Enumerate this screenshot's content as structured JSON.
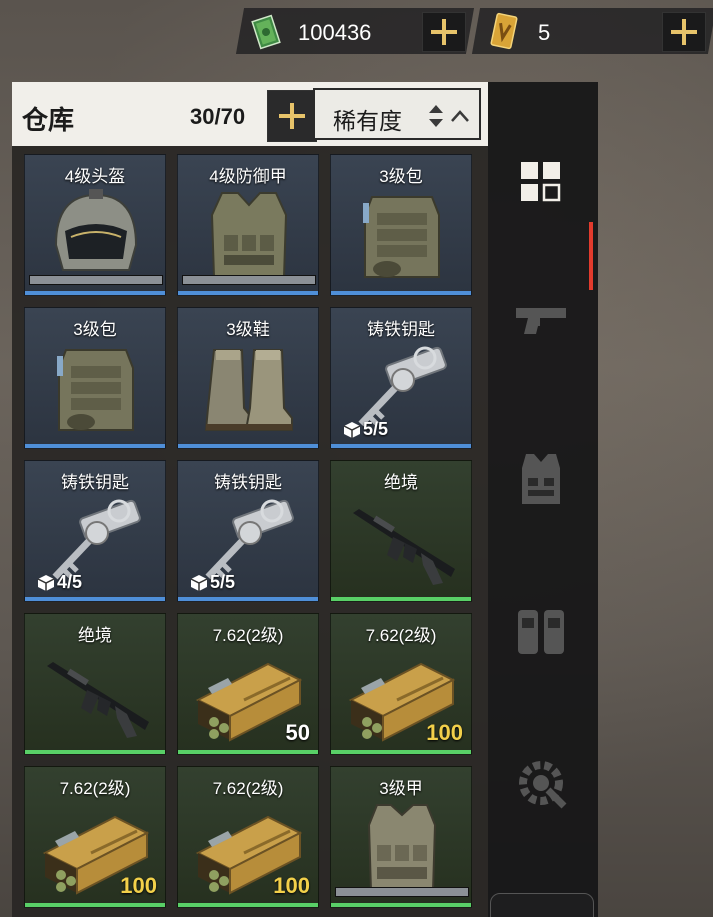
{
  "currency": {
    "cash": {
      "icon": "cash-stack-icon",
      "value": "100436"
    },
    "token": {
      "icon": "gold-ticket-icon",
      "value": "5"
    }
  },
  "warehouse": {
    "title": "仓库",
    "capacity": "30/70",
    "sort_label": "稀有度"
  },
  "items": [
    {
      "name": "4级头盔",
      "icon": "helmet-icon",
      "rarity": "blue",
      "durability": 1.0
    },
    {
      "name": "4级防御甲",
      "icon": "body-armor-icon",
      "rarity": "blue",
      "durability": 1.0
    },
    {
      "name": "3级包",
      "icon": "backpack-icon",
      "rarity": "blue"
    },
    {
      "name": "3级包",
      "icon": "backpack-icon",
      "rarity": "blue"
    },
    {
      "name": "3级鞋",
      "icon": "boots-icon",
      "rarity": "blue"
    },
    {
      "name": "铸铁钥匙",
      "icon": "key-icon",
      "rarity": "blue",
      "uses": "5/5"
    },
    {
      "name": "铸铁钥匙",
      "icon": "key-icon",
      "rarity": "blue",
      "uses": "4/5"
    },
    {
      "name": "铸铁钥匙",
      "icon": "key-icon",
      "rarity": "blue",
      "uses": "5/5"
    },
    {
      "name": "绝境",
      "icon": "rifle-icon",
      "rarity": "green"
    },
    {
      "name": "绝境",
      "icon": "rifle-icon",
      "rarity": "green"
    },
    {
      "name": "7.62(2级)",
      "icon": "ammo-box-icon",
      "rarity": "green",
      "quantity": "50",
      "quantity_color": "#ffffff"
    },
    {
      "name": "7.62(2级)",
      "icon": "ammo-box-icon",
      "rarity": "green",
      "quantity": "100",
      "quantity_color": "#f2d04a"
    },
    {
      "name": "7.62(2级)",
      "icon": "ammo-box-icon",
      "rarity": "green",
      "quantity": "100",
      "quantity_color": "#f2d04a"
    },
    {
      "name": "7.62(2级)",
      "icon": "ammo-box-icon",
      "rarity": "green",
      "quantity": "100",
      "quantity_color": "#f2d04a"
    },
    {
      "name": "3级甲",
      "icon": "vest-icon",
      "rarity": "green",
      "durability": 1.0
    }
  ],
  "sidenav": [
    {
      "name": "all-items-tab",
      "icon": "grid-icon",
      "active": true
    },
    {
      "name": "weapons-tab",
      "icon": "pistol-icon",
      "active": false
    },
    {
      "name": "armor-tab",
      "icon": "vest-icon",
      "active": false
    },
    {
      "name": "backpack-tab",
      "icon": "pouches-icon",
      "active": false
    },
    {
      "name": "mods-tab",
      "icon": "wrench-gear-icon",
      "active": false
    }
  ],
  "colors": {
    "rarity_blue_bar": "#4f8fd8",
    "rarity_green_bar": "#59d067",
    "accent_gold": "#e7c36a",
    "active_tab_red": "#e23b2d"
  }
}
